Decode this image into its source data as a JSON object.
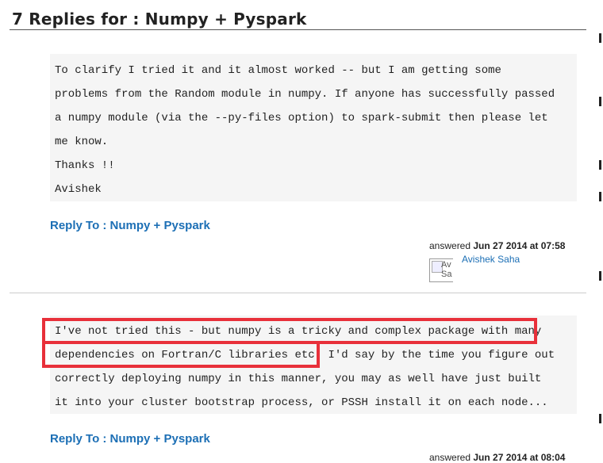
{
  "page": {
    "title": "7 Replies for : Numpy + Pyspark"
  },
  "replies": [
    {
      "lines": [
        "To clarify I tried it and it almost worked -- but I am getting some",
        "problems from the Random module in numpy. If anyone has successfully passed",
        "a numpy module (via the --py-files option) to spark-submit then please let",
        "me know.",
        "Thanks !!",
        "Avishek"
      ],
      "reply_link": "Reply To : Numpy + Pyspark",
      "answered_label": "answered",
      "answered_date": "Jun 27 2014 at 07:58",
      "user_name": "Avishek Saha",
      "avatar_alt": "Av Sa"
    },
    {
      "lines": [
        "I've not tried this - but numpy is a tricky and complex package with many",
        "dependencies on Fortran/C libraries etc. I'd say by the time you figure out",
        "correctly deploying numpy in this manner, you may as well have just built",
        "it into your cluster bootstrap process, or PSSH install it on each node..."
      ],
      "reply_link": "Reply To : Numpy + Pyspark",
      "answered_label": "answered",
      "answered_date": "Jun 27 2014 at 08:04"
    }
  ],
  "colors": {
    "link": "#1c6fb5",
    "highlight": "#e8303a",
    "code_bg": "#f5f5f5"
  }
}
